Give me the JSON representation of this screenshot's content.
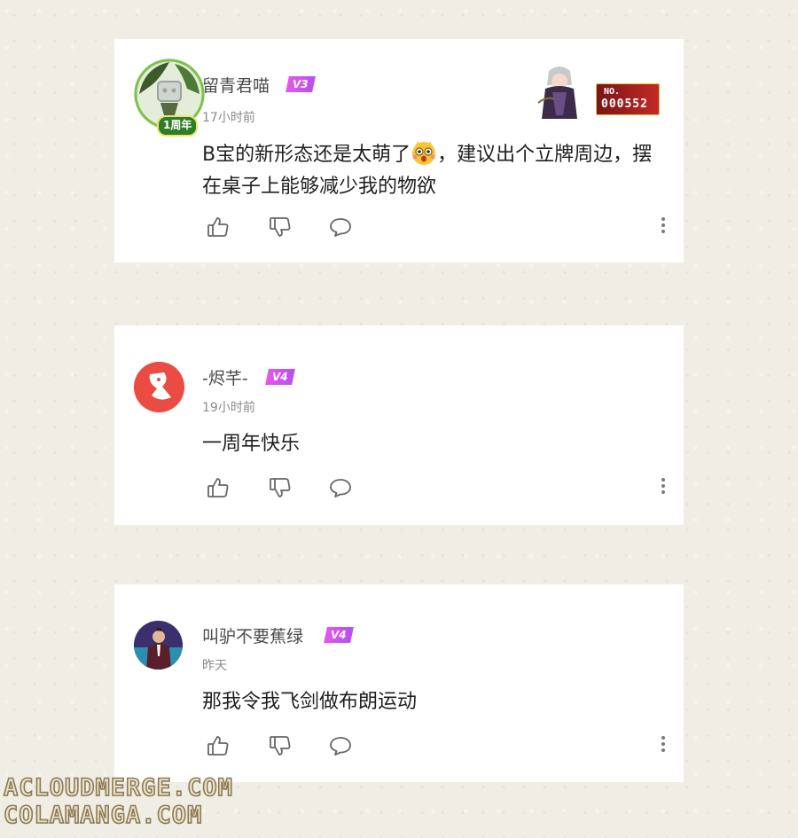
{
  "comments": [
    {
      "username": "留青君喵",
      "vip_level": "V3",
      "time": "17小时前",
      "text_before": "B宝的新形态还是太萌了",
      "emoji": "excited-face-emoji",
      "text_after": "，建议出个立牌周边，摆在桌子上能够减少我的物欲",
      "avatar_badge_label": "1周年",
      "fan_badge": {
        "prefix": "NO.",
        "number": "000552"
      }
    },
    {
      "username": "-烬芊-",
      "vip_level": "V4",
      "time": "19小时前",
      "text_before": "一周年快乐",
      "text_after": ""
    },
    {
      "username": "叫驴不要蕉绿",
      "vip_level": "V4",
      "time": "昨天",
      "text_before": "那我令我飞剑做布朗运动",
      "text_after": ""
    }
  ],
  "icons": {
    "like": "thumbs-up-icon",
    "dislike": "thumbs-down-icon",
    "reply": "chat-bubble-icon",
    "more": "vertical-ellipsis-icon"
  },
  "colors": {
    "vip_badge": "#c552ef",
    "background": "#efede4",
    "card": "#ffffff",
    "secondary_text": "#8a8a8a"
  },
  "watermarks": [
    "ACLOUDMERGE.COM",
    "COLAMANGA.COM"
  ]
}
